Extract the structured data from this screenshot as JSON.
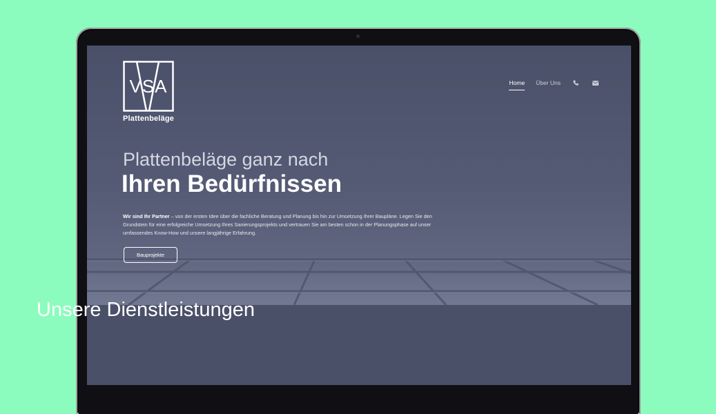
{
  "page": {
    "background_color": "#8bfcbd",
    "screen_color": "#4b5069"
  },
  "header": {
    "logo_mark": "VSA",
    "logo_word": "Plattenbeläge",
    "nav": [
      {
        "label": "Home",
        "active": true
      },
      {
        "label": "Über Uns",
        "active": false
      }
    ],
    "icons": [
      "phone-icon",
      "envelope-icon"
    ]
  },
  "hero": {
    "headline_line1": "Plattenbeläge ganz nach",
    "headline_line2": "Ihren Bedürfnissen",
    "intro_bold": "Wir sind Ihr Partner",
    "intro_text": " – von der ersten Idee über die fachliche Beratung und Planung bis hin zur Umsetzung Ihrer Baupläne. Legen Sie den Grundstein für eine erfolgreiche Umsetzung Ihres Sanierungsprojekts und vertrauen Sie am besten schon in der Planungsphase auf unser umfassendes Know-How und unsere langjährige Erfahrung.",
    "cta_label": "Bauprojekte"
  },
  "services": {
    "title": "Unsere Dienstleistungen"
  }
}
